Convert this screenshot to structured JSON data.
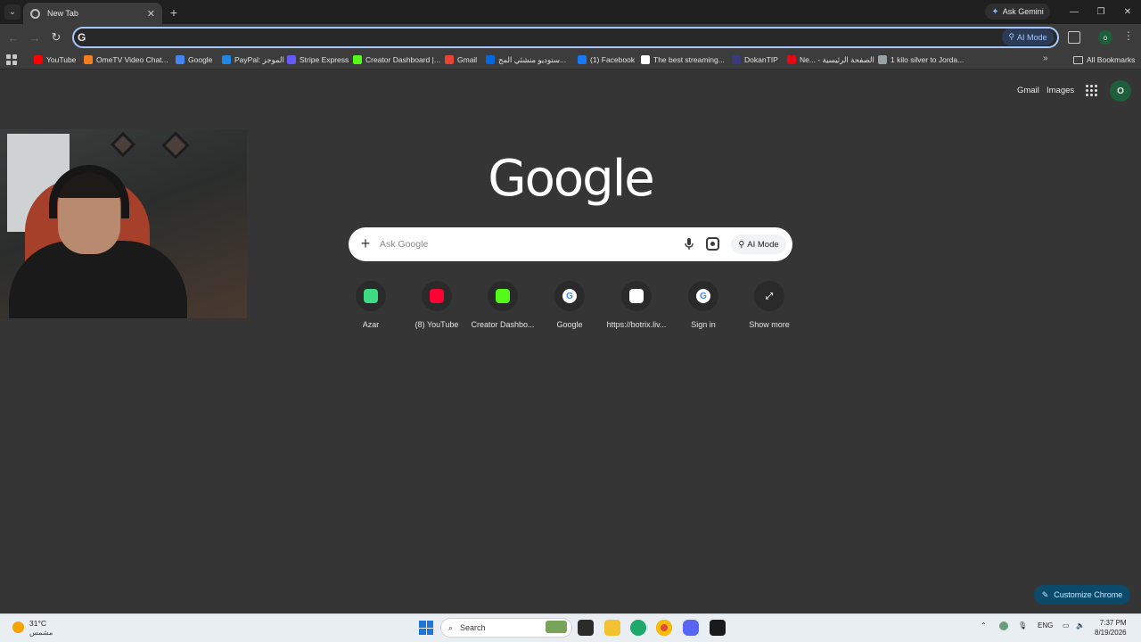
{
  "browser": {
    "tab_title": "New Tab",
    "ask_gemini": "Ask Gemini",
    "omnibox_ai_mode": "AI Mode",
    "profile_initial": "o"
  },
  "bookmarks": [
    {
      "label": "YouTube",
      "icon": "youtube-icon",
      "color": "#ff0000"
    },
    {
      "label": "OmeTV Video Chat...",
      "icon": "ometv-icon",
      "color": "#f47c20"
    },
    {
      "label": "Google",
      "icon": "google-icon",
      "color": "#4285f4"
    },
    {
      "label": "PayPal: الموجز",
      "icon": "paypal-icon",
      "color": "#1e88e5"
    },
    {
      "label": "Stripe Express",
      "icon": "stripe-icon",
      "color": "#635bff"
    },
    {
      "label": "Creator Dashboard |...",
      "icon": "kick-icon",
      "color": "#53fc18"
    },
    {
      "label": "Gmail",
      "icon": "gmail-icon",
      "color": "#ea4335"
    },
    {
      "label": "ستوديو منشئي المح...",
      "icon": "meta-icon",
      "color": "#0668e1"
    },
    {
      "label": "(1) Facebook",
      "icon": "facebook-icon",
      "color": "#1877f2"
    },
    {
      "label": "The best streaming...",
      "icon": "streaming-icon",
      "color": "#ffffff"
    },
    {
      "label": "DokanTIP",
      "icon": "dokantip-icon",
      "color": "#3a3a7a"
    },
    {
      "label": "Ne... - الصفحة الرئيسية",
      "icon": "netflix-icon",
      "color": "#e50914"
    },
    {
      "label": "1 kilo silver to Jorda...",
      "icon": "globe-icon",
      "color": "#9aa0a6"
    }
  ],
  "all_bookmarks": "All Bookmarks",
  "ntp": {
    "gmail": "Gmail",
    "images": "Images",
    "avatar_initial": "O",
    "logo": "Google",
    "search_placeholder": "Ask Google",
    "ai_mode": "AI Mode",
    "customize": "Customize Chrome"
  },
  "shortcuts": [
    {
      "label": "Azar",
      "icon": "azar-icon",
      "color": "#3ddc84"
    },
    {
      "label": "(8) YouTube",
      "icon": "youtube-icon",
      "color": "#ff0033"
    },
    {
      "label": "Creator Dashbo...",
      "icon": "kick-icon",
      "color": "#53fc18"
    },
    {
      "label": "Google",
      "icon": "google-icon",
      "color": "#4285f4"
    },
    {
      "label": "https://botrix.liv...",
      "icon": "botrix-icon",
      "color": "#ffffff"
    },
    {
      "label": "Sign in",
      "icon": "google-icon",
      "color": "#4285f4"
    },
    {
      "label": "Show more",
      "icon": "expand-icon",
      "color": "#e3e3e3"
    }
  ],
  "taskbar": {
    "temperature": "31°C",
    "condition": "مشمس",
    "search": "Search",
    "language": "ENG",
    "time": "7:37 PM",
    "date": "8/19/2026"
  }
}
